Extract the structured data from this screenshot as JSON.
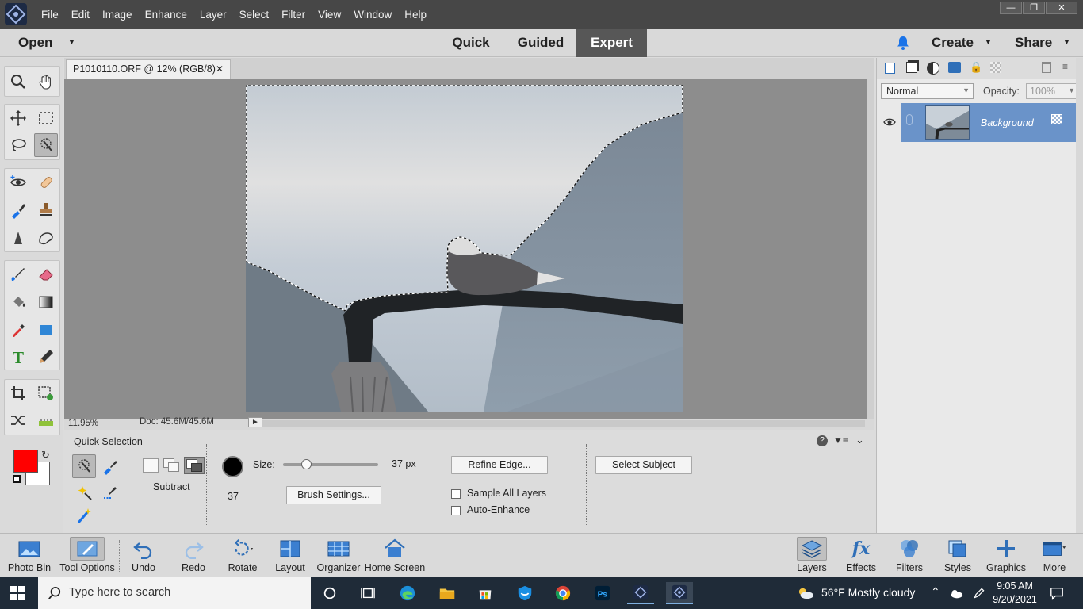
{
  "menu": {
    "items": [
      "File",
      "Edit",
      "Image",
      "Enhance",
      "Layer",
      "Select",
      "Filter",
      "View",
      "Window",
      "Help"
    ]
  },
  "modebar": {
    "open_label": "Open",
    "tabs": [
      "Quick",
      "Guided",
      "Expert"
    ],
    "active_tab": "Expert",
    "create_label": "Create",
    "share_label": "Share"
  },
  "document": {
    "tab_title": "P1010110.ORF @ 12% (RGB/8)",
    "zoom": "11.95%",
    "doc_info": "Doc: 45.6M/45.6M"
  },
  "tool_options": {
    "title": "Quick Selection",
    "mode_label": "Subtract",
    "size_label": "Size:",
    "size_value": "37 px",
    "size_fraction": 0.24,
    "brush_number": "37",
    "brush_settings_label": "Brush Settings...",
    "refine_edge_label": "Refine Edge...",
    "sample_all_layers_label": "Sample All Layers",
    "auto_enhance_label": "Auto-Enhance",
    "select_subject_label": "Select Subject"
  },
  "layers_panel": {
    "blend_mode": "Normal",
    "opacity_label": "Opacity:",
    "opacity_value": "100%",
    "layer_name": "Background"
  },
  "colors": {
    "foreground": "#ff0000",
    "background": "#ffffff",
    "accent": "#6a93c9"
  },
  "bottombar": {
    "left": [
      "Photo Bin",
      "Tool Options",
      "Undo",
      "Redo",
      "Rotate",
      "Layout",
      "Organizer",
      "Home Screen"
    ],
    "right": [
      "Layers",
      "Effects",
      "Filters",
      "Styles",
      "Graphics",
      "More"
    ]
  },
  "taskbar": {
    "search_placeholder": "Type here to search",
    "weather": "56°F  Mostly cloudy",
    "time": "9:05 AM",
    "date": "9/20/2021"
  }
}
